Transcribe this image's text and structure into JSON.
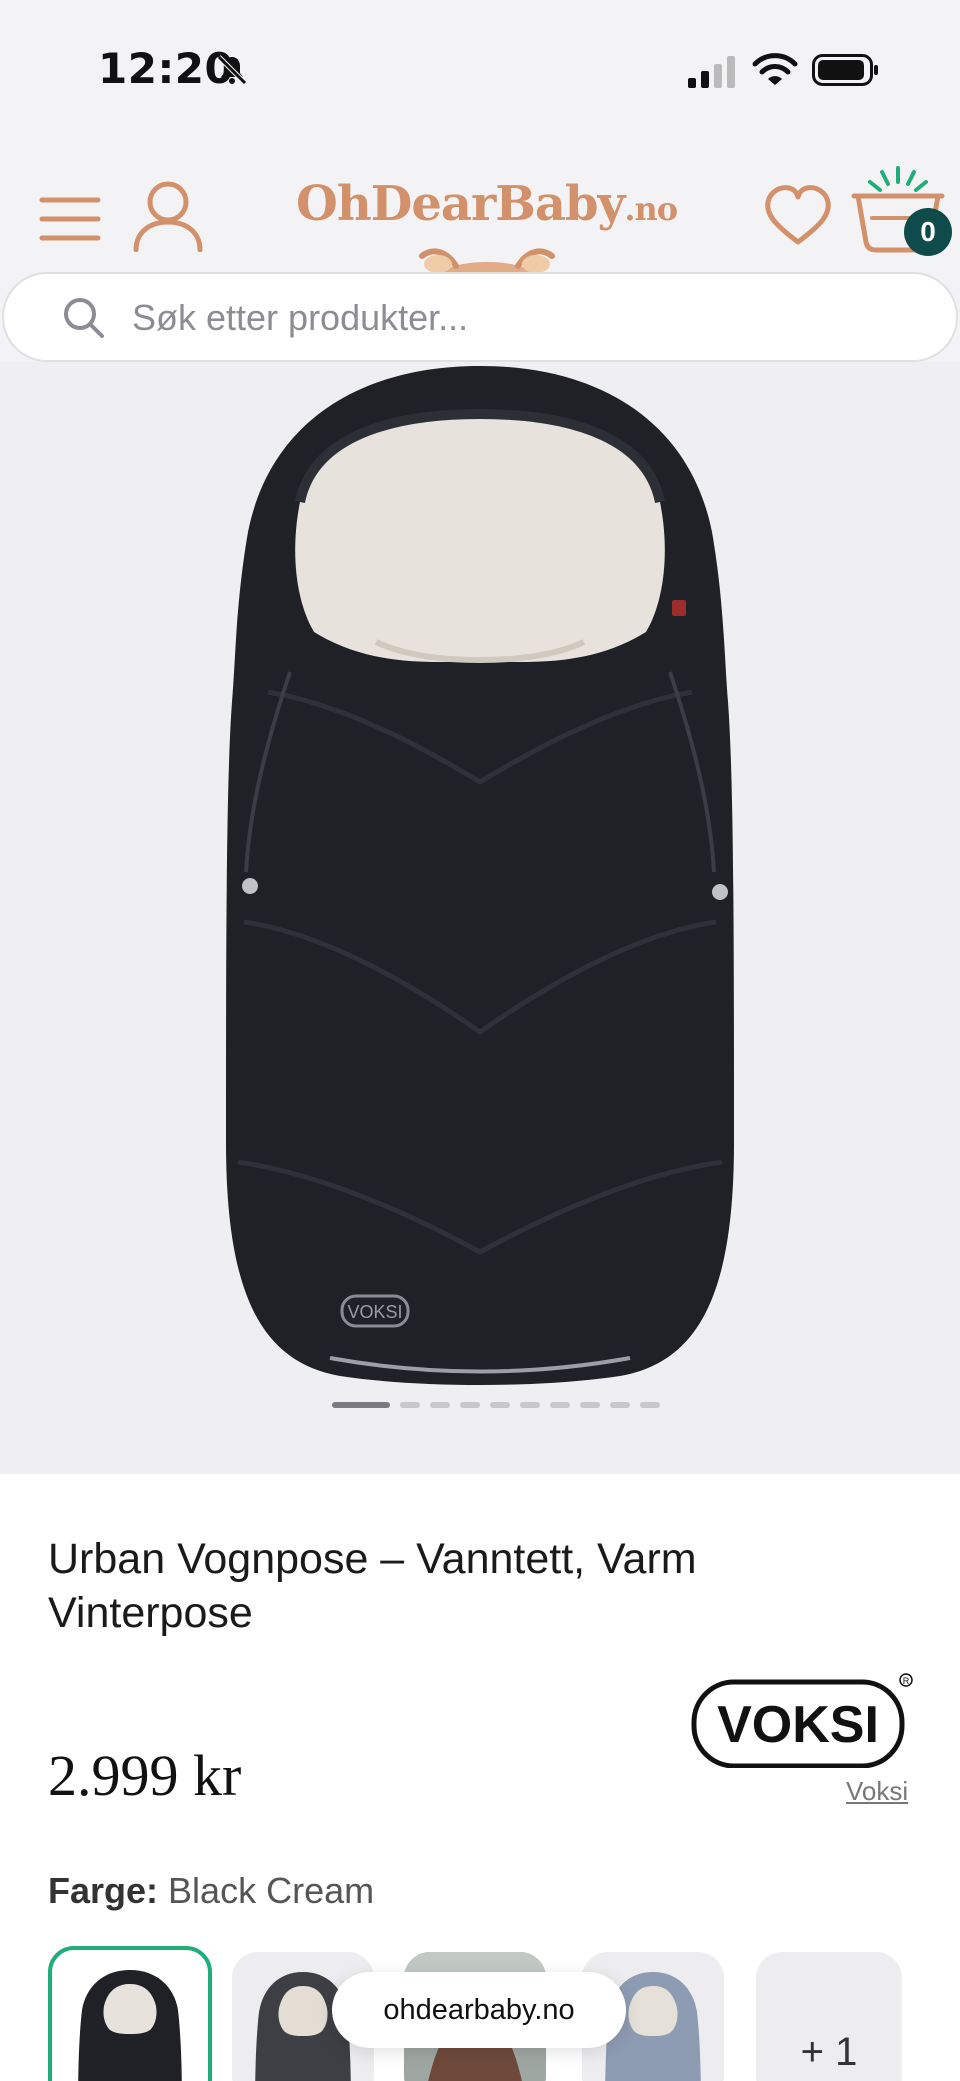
{
  "status_bar": {
    "time": "12:20",
    "icons": [
      "bell-slash-icon",
      "cellular-signal-icon",
      "wifi-icon",
      "battery-icon"
    ]
  },
  "header": {
    "logo_main": "OhDearBaby",
    "logo_suffix": ".no",
    "brand_color": "#d2916a",
    "cart_count": "0",
    "cart_badge_color": "#0e4b4a"
  },
  "search": {
    "placeholder": "Søk etter produkter..."
  },
  "gallery": {
    "image_count": 10,
    "active_index": 0
  },
  "product": {
    "title": "Urban Vognpose – Vanntett, Varm Vinterpose",
    "price": "2.999 kr",
    "brand_logo_text": "VOKSI",
    "brand_link": "Voksi",
    "color_label": "Farge:",
    "color_value": "Black Cream",
    "swatches": [
      "Black Cream",
      "Dark Grey",
      "Lifestyle",
      "Blue"
    ],
    "more_swatches": "+ 1",
    "selected_swatch_color": "#1fae7a"
  },
  "browser": {
    "url": "ohdearbaby.no"
  }
}
